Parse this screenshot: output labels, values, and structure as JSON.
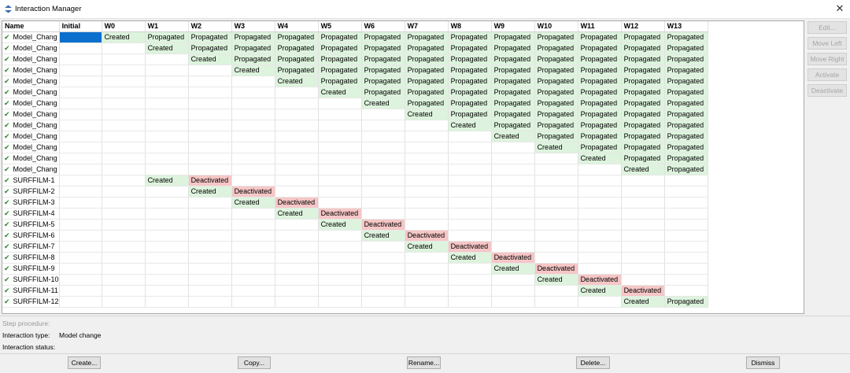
{
  "window": {
    "title": "Interaction Manager",
    "close_symbol": "✕"
  },
  "table": {
    "columns": [
      "Name",
      "Initial",
      "W0",
      "W1",
      "W2",
      "W3",
      "W4",
      "W5",
      "W6",
      "W7",
      "W8",
      "W9",
      "W10",
      "W11",
      "W12",
      "W13"
    ],
    "selected_cell": {
      "row": 0,
      "col": 1
    },
    "rows": [
      {
        "name": "Model_Chang",
        "cells": [
          "",
          "Created",
          "Propagated",
          "Propagated",
          "Propagated",
          "Propagated",
          "Propagated",
          "Propagated",
          "Propagated",
          "Propagated",
          "Propagated",
          "Propagated",
          "Propagated",
          "Propagated",
          "Propagated"
        ]
      },
      {
        "name": "Model_Chang",
        "cells": [
          "",
          "",
          "Created",
          "Propagated",
          "Propagated",
          "Propagated",
          "Propagated",
          "Propagated",
          "Propagated",
          "Propagated",
          "Propagated",
          "Propagated",
          "Propagated",
          "Propagated",
          "Propagated"
        ]
      },
      {
        "name": "Model_Chang",
        "cells": [
          "",
          "",
          "",
          "Created",
          "Propagated",
          "Propagated",
          "Propagated",
          "Propagated",
          "Propagated",
          "Propagated",
          "Propagated",
          "Propagated",
          "Propagated",
          "Propagated",
          "Propagated"
        ]
      },
      {
        "name": "Model_Chang",
        "cells": [
          "",
          "",
          "",
          "",
          "Created",
          "Propagated",
          "Propagated",
          "Propagated",
          "Propagated",
          "Propagated",
          "Propagated",
          "Propagated",
          "Propagated",
          "Propagated",
          "Propagated"
        ]
      },
      {
        "name": "Model_Chang",
        "cells": [
          "",
          "",
          "",
          "",
          "",
          "Created",
          "Propagated",
          "Propagated",
          "Propagated",
          "Propagated",
          "Propagated",
          "Propagated",
          "Propagated",
          "Propagated",
          "Propagated"
        ]
      },
      {
        "name": "Model_Chang",
        "cells": [
          "",
          "",
          "",
          "",
          "",
          "",
          "Created",
          "Propagated",
          "Propagated",
          "Propagated",
          "Propagated",
          "Propagated",
          "Propagated",
          "Propagated",
          "Propagated"
        ]
      },
      {
        "name": "Model_Chang",
        "cells": [
          "",
          "",
          "",
          "",
          "",
          "",
          "",
          "Created",
          "Propagated",
          "Propagated",
          "Propagated",
          "Propagated",
          "Propagated",
          "Propagated",
          "Propagated"
        ]
      },
      {
        "name": "Model_Chang",
        "cells": [
          "",
          "",
          "",
          "",
          "",
          "",
          "",
          "",
          "Created",
          "Propagated",
          "Propagated",
          "Propagated",
          "Propagated",
          "Propagated",
          "Propagated"
        ]
      },
      {
        "name": "Model_Chang",
        "cells": [
          "",
          "",
          "",
          "",
          "",
          "",
          "",
          "",
          "",
          "Created",
          "Propagated",
          "Propagated",
          "Propagated",
          "Propagated",
          "Propagated"
        ]
      },
      {
        "name": "Model_Chang",
        "cells": [
          "",
          "",
          "",
          "",
          "",
          "",
          "",
          "",
          "",
          "",
          "Created",
          "Propagated",
          "Propagated",
          "Propagated",
          "Propagated"
        ]
      },
      {
        "name": "Model_Chang",
        "cells": [
          "",
          "",
          "",
          "",
          "",
          "",
          "",
          "",
          "",
          "",
          "",
          "Created",
          "Propagated",
          "Propagated",
          "Propagated"
        ]
      },
      {
        "name": "Model_Chang",
        "cells": [
          "",
          "",
          "",
          "",
          "",
          "",
          "",
          "",
          "",
          "",
          "",
          "",
          "Created",
          "Propagated",
          "Propagated"
        ]
      },
      {
        "name": "Model_Chang",
        "cells": [
          "",
          "",
          "",
          "",
          "",
          "",
          "",
          "",
          "",
          "",
          "",
          "",
          "",
          "Created",
          "Propagated"
        ]
      },
      {
        "name": "SURFFILM-1",
        "cells": [
          "",
          "",
          "Created",
          "Deactivated",
          "",
          "",
          "",
          "",
          "",
          "",
          "",
          "",
          "",
          "",
          ""
        ]
      },
      {
        "name": "SURFFILM-2",
        "cells": [
          "",
          "",
          "",
          "Created",
          "Deactivated",
          "",
          "",
          "",
          "",
          "",
          "",
          "",
          "",
          "",
          ""
        ]
      },
      {
        "name": "SURFFILM-3",
        "cells": [
          "",
          "",
          "",
          "",
          "Created",
          "Deactivated",
          "",
          "",
          "",
          "",
          "",
          "",
          "",
          "",
          ""
        ]
      },
      {
        "name": "SURFFILM-4",
        "cells": [
          "",
          "",
          "",
          "",
          "",
          "Created",
          "Deactivated",
          "",
          "",
          "",
          "",
          "",
          "",
          "",
          ""
        ]
      },
      {
        "name": "SURFFILM-5",
        "cells": [
          "",
          "",
          "",
          "",
          "",
          "",
          "Created",
          "Deactivated",
          "",
          "",
          "",
          "",
          "",
          "",
          ""
        ]
      },
      {
        "name": "SURFFILM-6",
        "cells": [
          "",
          "",
          "",
          "",
          "",
          "",
          "",
          "Created",
          "Deactivated",
          "",
          "",
          "",
          "",
          "",
          ""
        ]
      },
      {
        "name": "SURFFILM-7",
        "cells": [
          "",
          "",
          "",
          "",
          "",
          "",
          "",
          "",
          "Created",
          "Deactivated",
          "",
          "",
          "",
          "",
          ""
        ]
      },
      {
        "name": "SURFFILM-8",
        "cells": [
          "",
          "",
          "",
          "",
          "",
          "",
          "",
          "",
          "",
          "Created",
          "Deactivated",
          "",
          "",
          "",
          ""
        ]
      },
      {
        "name": "SURFFILM-9",
        "cells": [
          "",
          "",
          "",
          "",
          "",
          "",
          "",
          "",
          "",
          "",
          "Created",
          "Deactivated",
          "",
          "",
          ""
        ]
      },
      {
        "name": "SURFFILM-10",
        "cells": [
          "",
          "",
          "",
          "",
          "",
          "",
          "",
          "",
          "",
          "",
          "",
          "Created",
          "Deactivated",
          "",
          ""
        ]
      },
      {
        "name": "SURFFILM-11",
        "cells": [
          "",
          "",
          "",
          "",
          "",
          "",
          "",
          "",
          "",
          "",
          "",
          "",
          "Created",
          "Deactivated",
          ""
        ]
      },
      {
        "name": "SURFFILM-12",
        "cells": [
          "",
          "",
          "",
          "",
          "",
          "",
          "",
          "",
          "",
          "",
          "",
          "",
          "",
          "Created",
          "Propagated"
        ]
      }
    ]
  },
  "side_buttons": [
    "Edit...",
    "Move Left",
    "Move Right",
    "Activate",
    "Deactivate"
  ],
  "info": {
    "step_procedure_label": "Step procedure:",
    "interaction_type_label": "Interaction type:",
    "interaction_type_value": "Model change",
    "interaction_status_label": "Interaction status:"
  },
  "bottom_buttons": {
    "create": "Create...",
    "copy": "Copy...",
    "rename": "Rename...",
    "delete": "Delete...",
    "dismiss": "Dismiss"
  },
  "colors": {
    "created": "#ddf3dd",
    "propagated": "#ddf3dd",
    "deactivated": "#f6c6c6",
    "selected": "#0b6fce",
    "check": "#2e8b2e"
  },
  "icons": {
    "title": "interaction-manager-icon",
    "row_status": "checkmark-icon",
    "close": "close-icon"
  }
}
